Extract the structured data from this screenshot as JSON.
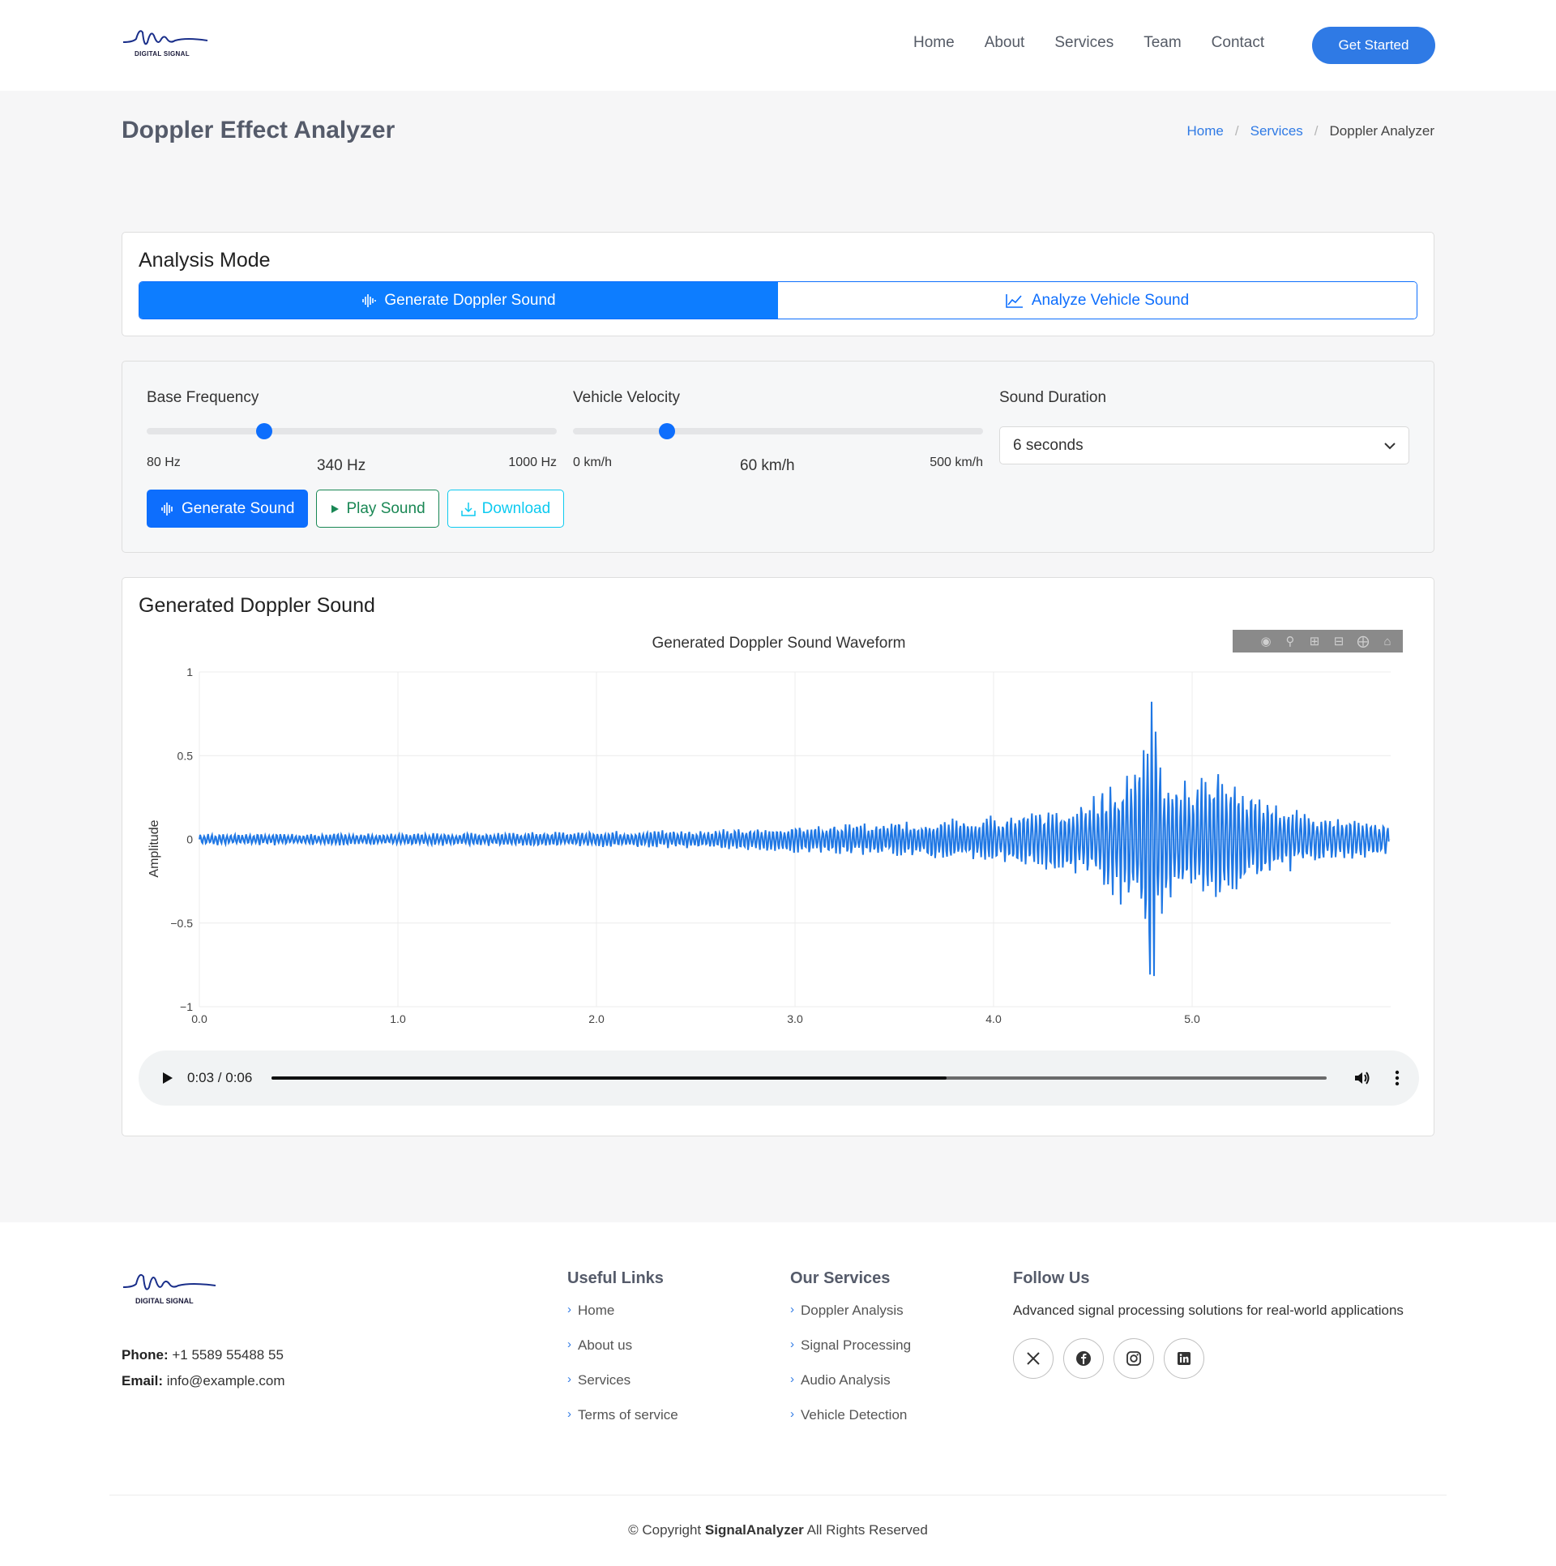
{
  "brand": {
    "logo_text": "DIGITAL SIGNAL"
  },
  "nav": {
    "items": [
      "Home",
      "About",
      "Services",
      "Team",
      "Contact"
    ],
    "cta": "Get Started"
  },
  "page": {
    "title": "Doppler Effect Analyzer",
    "breadcrumb": [
      "Home",
      "Services",
      "Doppler Analyzer"
    ],
    "breadcrumb_sep": "/"
  },
  "mode": {
    "title": "Analysis Mode",
    "options": [
      "Generate Doppler Sound",
      "Analyze Vehicle Sound"
    ],
    "active_index": 0
  },
  "controls": {
    "frequency": {
      "label": "Base Frequency",
      "min_label": "80 Hz",
      "max_label": "1000 Hz",
      "value_label": "340 Hz",
      "min": 80,
      "max": 1000,
      "value": 340
    },
    "velocity": {
      "label": "Vehicle Velocity",
      "min_label": "0 km/h",
      "max_label": "500 km/h",
      "value_label": "60 km/h",
      "min": 0,
      "max": 500,
      "value": 60
    },
    "duration": {
      "label": "Sound Duration",
      "selected": "6 seconds"
    },
    "buttons": {
      "generate": "Generate Sound",
      "play": "Play Sound",
      "download": "Download"
    }
  },
  "output": {
    "title": "Generated Doppler Sound",
    "audio": {
      "time": "0:03 / 0:06",
      "progress": 0.64
    }
  },
  "chart_data": {
    "type": "line",
    "title": "Generated Doppler Sound Waveform",
    "xlabel": "",
    "ylabel": "Amplitude",
    "xlim": [
      0,
      6
    ],
    "ylim": [
      -1,
      1
    ],
    "x_ticks": [
      "0.0",
      "1.0",
      "2.0",
      "3.0",
      "4.0",
      "5.0"
    ],
    "y_ticks": [
      "1",
      "0.5",
      "0",
      "−0.5",
      "−1"
    ],
    "grid": true,
    "line_color": "#1f77e4",
    "envelope": {
      "t": [
        0,
        1.0,
        2.0,
        2.6,
        3.0,
        3.5,
        4.0,
        4.3,
        4.5,
        4.65,
        4.75,
        4.78,
        4.85,
        4.95,
        5.0,
        5.1,
        5.3,
        5.6,
        6.0
      ],
      "amplitude": [
        0.03,
        0.03,
        0.04,
        0.05,
        0.07,
        0.09,
        0.12,
        0.16,
        0.22,
        0.35,
        0.45,
        0.9,
        0.4,
        0.3,
        0.28,
        0.38,
        0.25,
        0.12,
        0.09
      ]
    }
  },
  "footer": {
    "phone_label": "Phone:",
    "phone": "+1 5589 55488 55",
    "email_label": "Email:",
    "email": "info@example.com",
    "useful_links": {
      "title": "Useful Links",
      "items": [
        "Home",
        "About us",
        "Services",
        "Terms of service"
      ]
    },
    "services": {
      "title": "Our Services",
      "items": [
        "Doppler Analysis",
        "Signal Processing",
        "Audio Analysis",
        "Vehicle Detection"
      ]
    },
    "follow": {
      "title": "Follow Us",
      "text": "Advanced signal processing solutions for real-world applications"
    },
    "copyright_prefix": "© Copyright",
    "copyright_brand": "SignalAnalyzer",
    "copyright_suffix": "All Rights Reserved"
  },
  "colors": {
    "accent": "#2f7ae5",
    "primary": "#0d6efd",
    "success": "#198754",
    "info": "#0dcaf0"
  }
}
